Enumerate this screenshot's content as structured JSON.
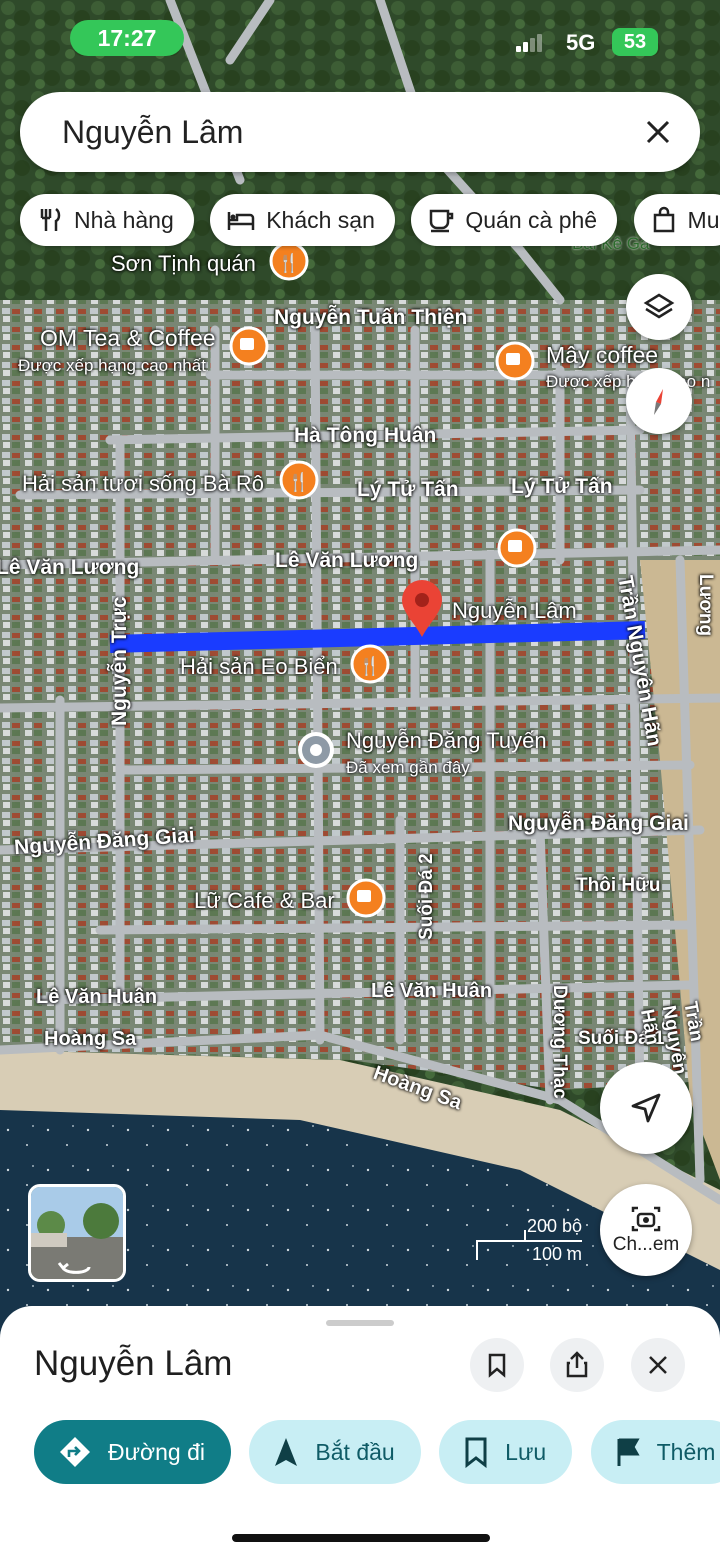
{
  "status_bar": {
    "time": "17:27",
    "network": "5G",
    "battery": "53"
  },
  "search": {
    "query": "Nguyễn Lâm"
  },
  "chips": [
    {
      "label": "Nhà hàng",
      "icon": "restaurant-icon"
    },
    {
      "label": "Khách sạn",
      "icon": "hotel-icon"
    },
    {
      "label": "Quán cà phê",
      "icon": "coffee-icon"
    },
    {
      "label": "Mu",
      "icon": "shopping-bag-icon"
    }
  ],
  "map": {
    "selected_street": "Nguyễn Lâm",
    "places": {
      "son_tinh": "Sơn Tịnh quán",
      "om_tea": "OM Tea & Coffee",
      "om_tea_sub": "Được xếp hạng cao nhất",
      "may_coffee": "Mây coffee",
      "may_coffee_sub": "Được xếp hạng cao n",
      "ba_ro": "Hải sản tươi sống Bà Rô",
      "eo_bien": "Hải sản Eo Biển",
      "nguyen_dang_tuyen": "Nguyễn Đăng Tuyến",
      "nguyen_dang_tuyen_sub": "Đã xem gần đây",
      "lu_cafe": "Lữ Cafe & Bar",
      "bai_ke_ga": "Bãi Kê Gà"
    },
    "streets": {
      "nguyen_tuan_thien": "Nguyễn Tuấn Thiện",
      "ha_tong_huan": "Hà Tông Huân",
      "ly_tu_tan_1": "Lý Tử Tấn",
      "ly_tu_tan_2": "Lý Tử Tấn",
      "le_van_luong_1": "Lê Văn Lương",
      "le_van_luong_2": "Lê Văn Lương",
      "nguyen_truc": "Nguyễn Trực",
      "tran_nguyen_han_1": "Trần Nguyên Hãn",
      "tran_nguyen_han_2": "Trần Nguyên Hãn",
      "luong": "Lương",
      "nguyen_dang_giai_1": "Nguyễn Đăng Giai",
      "nguyen_dang_giai_2": "Nguyễn Đăng Giai",
      "thoi_huu": "Thôi Hữu",
      "suoi_da_2": "Suối Đá 2",
      "suoi_da_1": "Suối Đá 1",
      "duong_thac": "Dương Thạc",
      "le_van_huan_1": "Lê Văn Huân",
      "le_van_huan_2": "Lê Văn Huân",
      "hoang_sa_1": "Hoàng Sa",
      "hoang_sa_2": "Hoàng Sa"
    },
    "scale": {
      "feet": "200 bộ",
      "meters": "100 m"
    },
    "camera_label": "Ch...em"
  },
  "sheet": {
    "title": "Nguyễn Lâm",
    "actions": [
      {
        "label": "Đường đi"
      },
      {
        "label": "Bắt đầu"
      },
      {
        "label": "Lưu"
      },
      {
        "label": "Thêm"
      }
    ]
  },
  "colors": {
    "accent": "#107d87",
    "accent_light": "#c8eef4",
    "route": "#1a3cff",
    "pin": "#ea4335",
    "poi_food": "#f4801f"
  }
}
